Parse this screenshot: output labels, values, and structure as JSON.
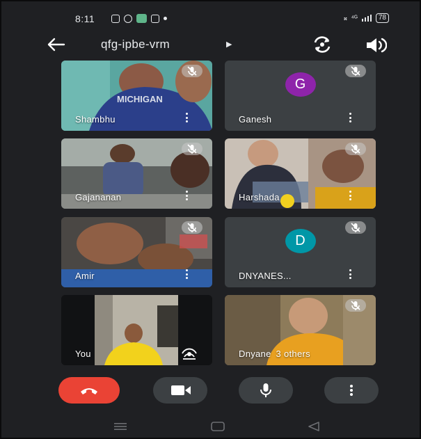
{
  "status_bar": {
    "time": "8:11",
    "network": "⁴ᴳ",
    "battery": "78"
  },
  "meeting": {
    "code": "qfg-ipbe-vrm"
  },
  "participants": [
    {
      "name": "Shambhu",
      "muted": true,
      "has_video": true
    },
    {
      "name": "Ganesh",
      "muted": true,
      "has_video": false,
      "initial": "G",
      "avatar_color": "#8e24aa"
    },
    {
      "name": "Gajananan",
      "muted": true,
      "has_video": true
    },
    {
      "name": "Harshada",
      "muted": true,
      "has_video": true
    },
    {
      "name": "Amir",
      "muted": true,
      "has_video": true
    },
    {
      "name": "DNYANES...",
      "muted": true,
      "has_video": false,
      "initial": "D",
      "avatar_color": "#0097a7"
    },
    {
      "name": "You",
      "muted": false,
      "has_video": true
    },
    {
      "name": "Dnyane",
      "extra": "3 others",
      "muted": true,
      "has_video": true
    }
  ],
  "controls": [
    "end-call",
    "camera",
    "microphone",
    "more-options"
  ],
  "colors": {
    "background": "#1f2023",
    "tile": "#3c4043",
    "end_call": "#ea4335"
  }
}
